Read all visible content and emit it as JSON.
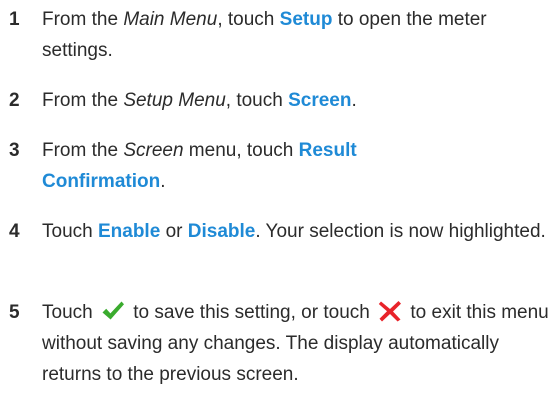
{
  "steps": [
    {
      "number": "1",
      "p1": "From the ",
      "italic": "Main Menu",
      "p2": ", touch ",
      "keyword": "Setup",
      "p3": " to open the meter settings."
    },
    {
      "number": "2",
      "p1": "From the ",
      "italic": "Setup Menu",
      "p2": ", touch ",
      "keyword": "Screen",
      "p3": "."
    },
    {
      "number": "3",
      "p1": "From the ",
      "italic": "Screen",
      "p2": " menu, touch ",
      "keyword": "Result Confirmation",
      "p3": "."
    },
    {
      "number": "4",
      "p1": "Touch ",
      "keyword1": "Enable",
      "p2": " or ",
      "keyword2": "Disable",
      "p3": ". Your selection is now highlighted."
    },
    {
      "number": "5",
      "p1": "Touch ",
      "icon1": "checkmark-icon",
      "p2": " to save this setting, or touch ",
      "icon2": "x-cancel-icon",
      "p3": " to exit this menu without saving any changes. The display automatically returns to the previous screen."
    }
  ],
  "colors": {
    "keyword": "#1f8ad6",
    "text": "#2b2b2b",
    "checkmark": "#3aab2e",
    "cancel": "#e8232a"
  }
}
